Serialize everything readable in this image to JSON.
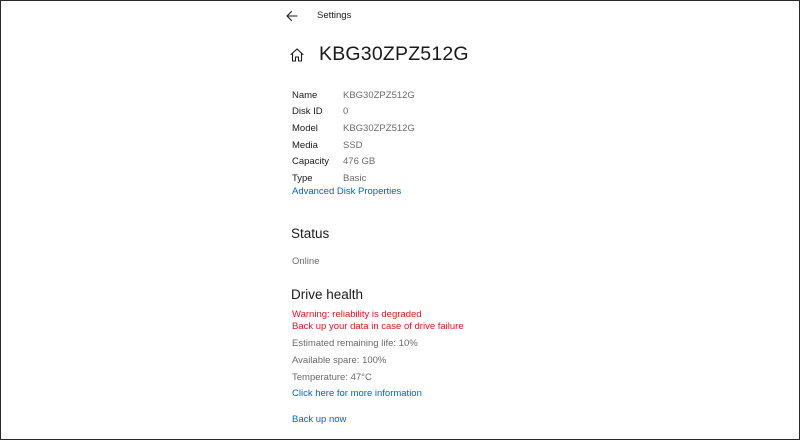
{
  "window": {
    "app_title": "Settings"
  },
  "header": {
    "title": "KBG30ZPZ512G",
    "home_icon": "home-icon",
    "back_icon": "back-arrow-icon"
  },
  "properties": [
    {
      "label": "Name",
      "value": "KBG30ZPZ512G"
    },
    {
      "label": "Disk ID",
      "value": "0"
    },
    {
      "label": "Model",
      "value": "KBG30ZPZ512G"
    },
    {
      "label": "Media",
      "value": "SSD"
    },
    {
      "label": "Capacity",
      "value": "476 GB"
    },
    {
      "label": "Type",
      "value": "Basic"
    }
  ],
  "advanced_link": "Advanced Disk Properties",
  "status": {
    "title": "Status",
    "value": "Online"
  },
  "drive_health": {
    "title": "Drive health",
    "warning_line1": "Warning: reliability is degraded",
    "warning_line2": "Back up your data in case of drive failure",
    "remaining_life": "Estimated remaining life: 10%",
    "available_spare": "Available spare: 100%",
    "temperature": "Temperature: 47°C",
    "more_info_link": "Click here for more information",
    "backup_link": "Back up now"
  },
  "colors": {
    "accent_link": "#0067c0",
    "warning": "#e81123",
    "secondary_text": "#6b6b6b"
  }
}
